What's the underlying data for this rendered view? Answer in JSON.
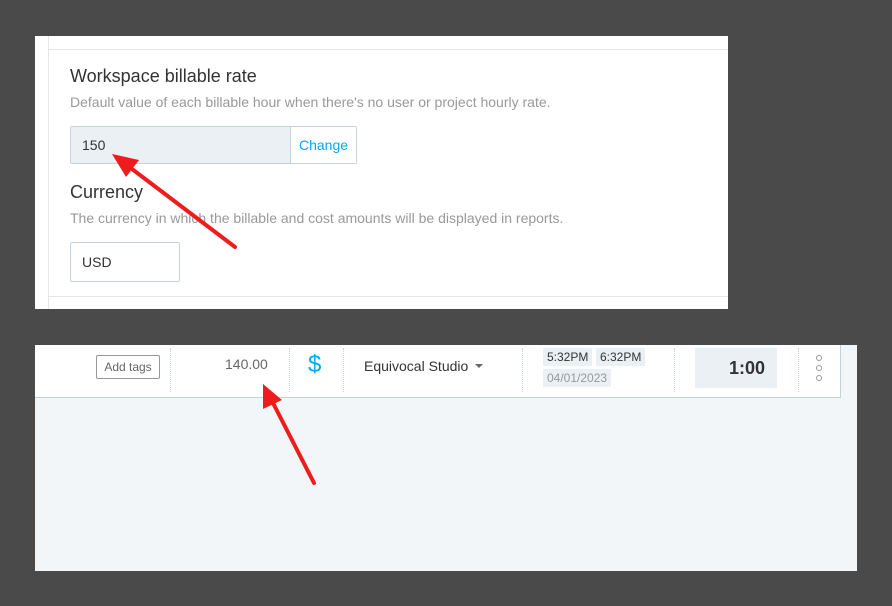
{
  "settings": {
    "billable_rate_title": "Workspace billable rate",
    "billable_rate_desc": "Default value of each billable hour when there's no user or project hourly rate.",
    "billable_rate_value": "150",
    "change_label": "Change",
    "currency_title": "Currency",
    "currency_desc": "The currency in which the billable and cost amounts will be displayed in reports.",
    "currency_value": "USD"
  },
  "entry": {
    "add_tags_label": "Add tags",
    "amount": "140.00",
    "billable_icon": "dollar-icon",
    "project": "Equivocal Studio",
    "start_time": "5:32PM",
    "end_time": "6:32PM",
    "date": "04/01/2023",
    "duration": "1:00"
  },
  "colors": {
    "accent": "#03a9f4",
    "annotation_arrow": "#ee1c1c",
    "backdrop": "#4a4a4a"
  }
}
